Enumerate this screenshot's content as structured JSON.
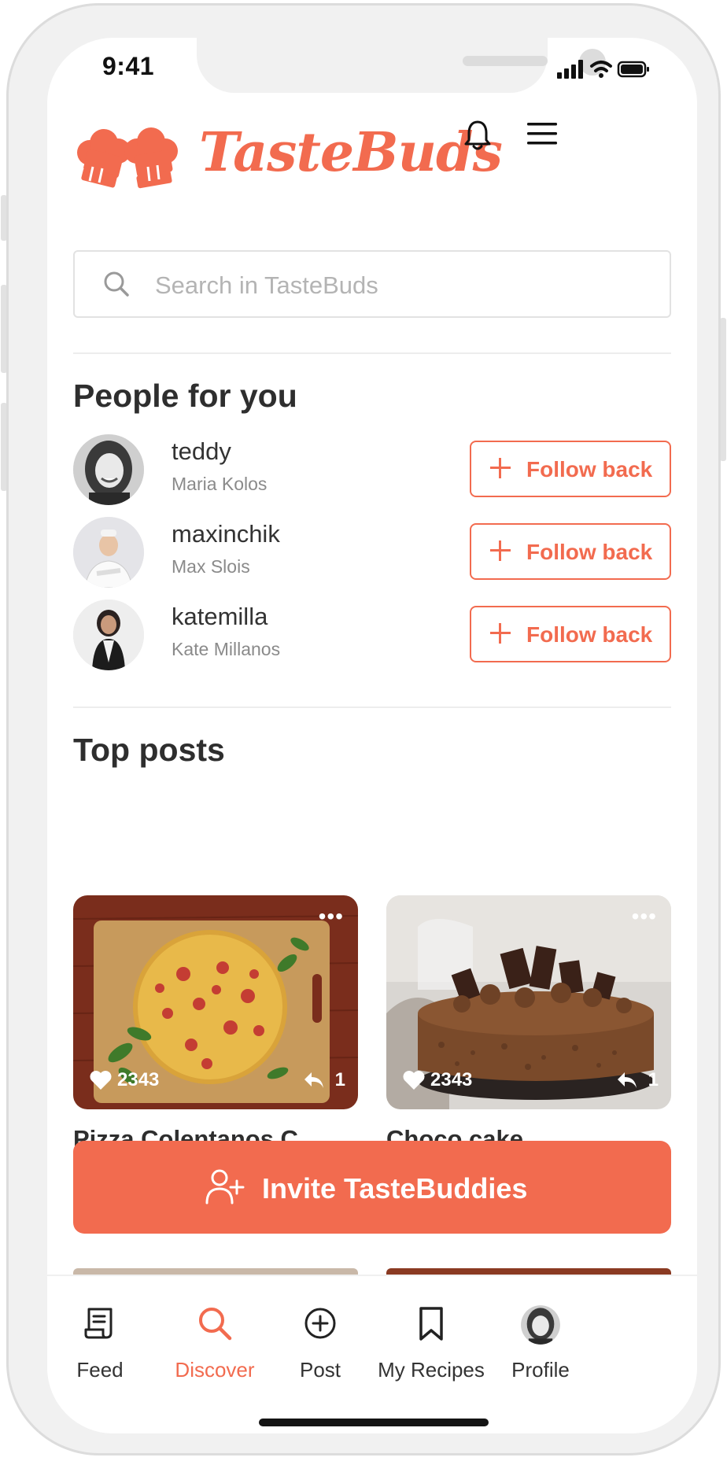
{
  "status": {
    "time": "9:41"
  },
  "brand": {
    "name": "TasteBuds"
  },
  "search": {
    "placeholder": "Search in TasteBuds"
  },
  "people": {
    "title": "People for you",
    "items": [
      {
        "username": "teddy",
        "fullname": "Maria Kolos",
        "button": "Follow back"
      },
      {
        "username": "maxinchik",
        "fullname": "Max Slois",
        "button": "Follow back"
      },
      {
        "username": "katemilla",
        "fullname": "Kate Millanos",
        "button": "Follow back"
      }
    ]
  },
  "top_posts": {
    "title": "Top posts",
    "items": [
      {
        "title": "Pizza Colentanos C",
        "likes": "2343",
        "replies": "1"
      },
      {
        "title": "Choco cake",
        "likes": "2343",
        "replies": "1"
      }
    ]
  },
  "invite": {
    "label": "Invite TasteBuddies"
  },
  "tabs": [
    {
      "label": "Feed",
      "icon": "feed-icon",
      "active": false
    },
    {
      "label": "Discover",
      "icon": "search-icon",
      "active": true
    },
    {
      "label": "Post",
      "icon": "plus-circle-icon",
      "active": false
    },
    {
      "label": "My Recipes",
      "icon": "bookmark-icon",
      "active": false
    },
    {
      "label": "Profile",
      "icon": "avatar",
      "active": false
    }
  ],
  "colors": {
    "accent": "#f26b4f",
    "text": "#2e2e2e",
    "muted": "#8a8a8a"
  }
}
